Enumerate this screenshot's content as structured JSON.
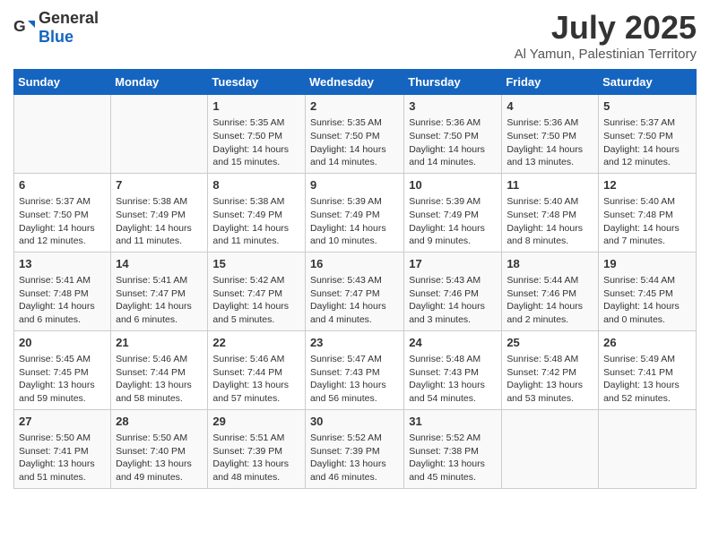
{
  "header": {
    "logo_general": "General",
    "logo_blue": "Blue",
    "title": "July 2025",
    "subtitle": "Al Yamun, Palestinian Territory"
  },
  "days_of_week": [
    "Sunday",
    "Monday",
    "Tuesday",
    "Wednesday",
    "Thursday",
    "Friday",
    "Saturday"
  ],
  "weeks": [
    [
      {
        "day": "",
        "content": ""
      },
      {
        "day": "",
        "content": ""
      },
      {
        "day": "1",
        "content": "Sunrise: 5:35 AM\nSunset: 7:50 PM\nDaylight: 14 hours and 15 minutes."
      },
      {
        "day": "2",
        "content": "Sunrise: 5:35 AM\nSunset: 7:50 PM\nDaylight: 14 hours and 14 minutes."
      },
      {
        "day": "3",
        "content": "Sunrise: 5:36 AM\nSunset: 7:50 PM\nDaylight: 14 hours and 14 minutes."
      },
      {
        "day": "4",
        "content": "Sunrise: 5:36 AM\nSunset: 7:50 PM\nDaylight: 14 hours and 13 minutes."
      },
      {
        "day": "5",
        "content": "Sunrise: 5:37 AM\nSunset: 7:50 PM\nDaylight: 14 hours and 12 minutes."
      }
    ],
    [
      {
        "day": "6",
        "content": "Sunrise: 5:37 AM\nSunset: 7:50 PM\nDaylight: 14 hours and 12 minutes."
      },
      {
        "day": "7",
        "content": "Sunrise: 5:38 AM\nSunset: 7:49 PM\nDaylight: 14 hours and 11 minutes."
      },
      {
        "day": "8",
        "content": "Sunrise: 5:38 AM\nSunset: 7:49 PM\nDaylight: 14 hours and 11 minutes."
      },
      {
        "day": "9",
        "content": "Sunrise: 5:39 AM\nSunset: 7:49 PM\nDaylight: 14 hours and 10 minutes."
      },
      {
        "day": "10",
        "content": "Sunrise: 5:39 AM\nSunset: 7:49 PM\nDaylight: 14 hours and 9 minutes."
      },
      {
        "day": "11",
        "content": "Sunrise: 5:40 AM\nSunset: 7:48 PM\nDaylight: 14 hours and 8 minutes."
      },
      {
        "day": "12",
        "content": "Sunrise: 5:40 AM\nSunset: 7:48 PM\nDaylight: 14 hours and 7 minutes."
      }
    ],
    [
      {
        "day": "13",
        "content": "Sunrise: 5:41 AM\nSunset: 7:48 PM\nDaylight: 14 hours and 6 minutes."
      },
      {
        "day": "14",
        "content": "Sunrise: 5:41 AM\nSunset: 7:47 PM\nDaylight: 14 hours and 6 minutes."
      },
      {
        "day": "15",
        "content": "Sunrise: 5:42 AM\nSunset: 7:47 PM\nDaylight: 14 hours and 5 minutes."
      },
      {
        "day": "16",
        "content": "Sunrise: 5:43 AM\nSunset: 7:47 PM\nDaylight: 14 hours and 4 minutes."
      },
      {
        "day": "17",
        "content": "Sunrise: 5:43 AM\nSunset: 7:46 PM\nDaylight: 14 hours and 3 minutes."
      },
      {
        "day": "18",
        "content": "Sunrise: 5:44 AM\nSunset: 7:46 PM\nDaylight: 14 hours and 2 minutes."
      },
      {
        "day": "19",
        "content": "Sunrise: 5:44 AM\nSunset: 7:45 PM\nDaylight: 14 hours and 0 minutes."
      }
    ],
    [
      {
        "day": "20",
        "content": "Sunrise: 5:45 AM\nSunset: 7:45 PM\nDaylight: 13 hours and 59 minutes."
      },
      {
        "day": "21",
        "content": "Sunrise: 5:46 AM\nSunset: 7:44 PM\nDaylight: 13 hours and 58 minutes."
      },
      {
        "day": "22",
        "content": "Sunrise: 5:46 AM\nSunset: 7:44 PM\nDaylight: 13 hours and 57 minutes."
      },
      {
        "day": "23",
        "content": "Sunrise: 5:47 AM\nSunset: 7:43 PM\nDaylight: 13 hours and 56 minutes."
      },
      {
        "day": "24",
        "content": "Sunrise: 5:48 AM\nSunset: 7:43 PM\nDaylight: 13 hours and 54 minutes."
      },
      {
        "day": "25",
        "content": "Sunrise: 5:48 AM\nSunset: 7:42 PM\nDaylight: 13 hours and 53 minutes."
      },
      {
        "day": "26",
        "content": "Sunrise: 5:49 AM\nSunset: 7:41 PM\nDaylight: 13 hours and 52 minutes."
      }
    ],
    [
      {
        "day": "27",
        "content": "Sunrise: 5:50 AM\nSunset: 7:41 PM\nDaylight: 13 hours and 51 minutes."
      },
      {
        "day": "28",
        "content": "Sunrise: 5:50 AM\nSunset: 7:40 PM\nDaylight: 13 hours and 49 minutes."
      },
      {
        "day": "29",
        "content": "Sunrise: 5:51 AM\nSunset: 7:39 PM\nDaylight: 13 hours and 48 minutes."
      },
      {
        "day": "30",
        "content": "Sunrise: 5:52 AM\nSunset: 7:39 PM\nDaylight: 13 hours and 46 minutes."
      },
      {
        "day": "31",
        "content": "Sunrise: 5:52 AM\nSunset: 7:38 PM\nDaylight: 13 hours and 45 minutes."
      },
      {
        "day": "",
        "content": ""
      },
      {
        "day": "",
        "content": ""
      }
    ]
  ]
}
